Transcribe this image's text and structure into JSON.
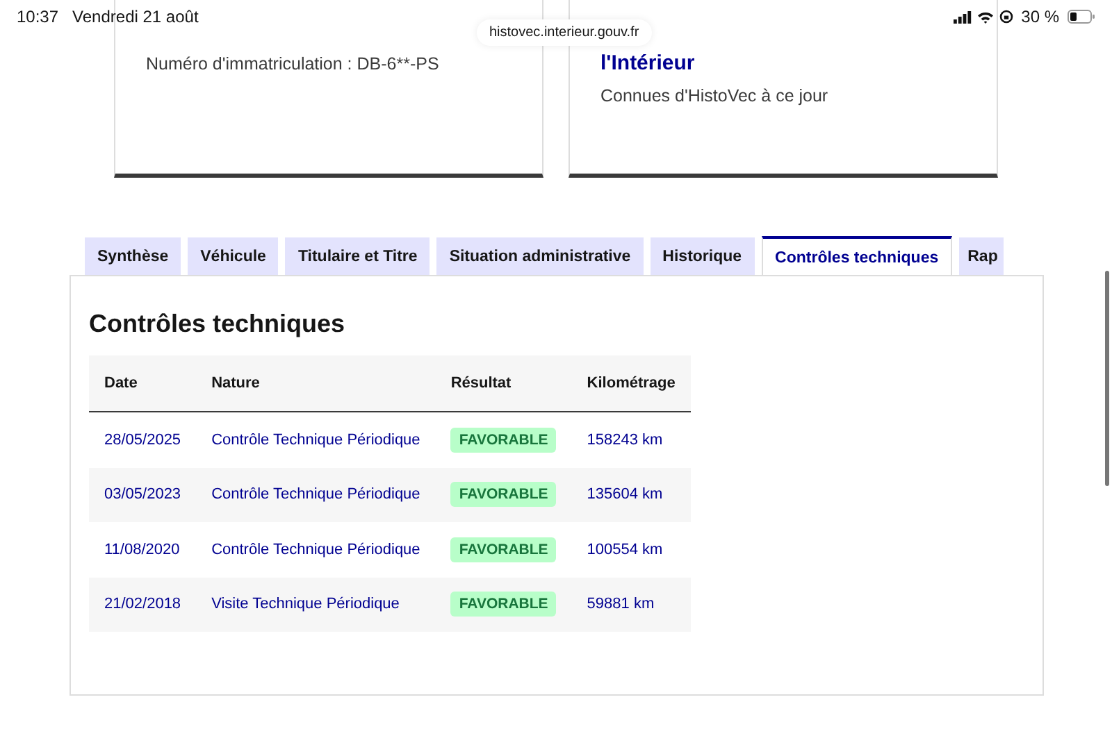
{
  "status_bar": {
    "time": "10:37",
    "date": "Vendredi 21 août",
    "url": "histovec.interieur.gouv.fr",
    "battery": "30 %"
  },
  "cards": [
    {
      "text": "Numéro d'immatriculation : DB-6**-PS"
    },
    {
      "title": "l'Intérieur",
      "text": "Connues d'HistoVec à ce jour"
    }
  ],
  "tabs": [
    {
      "label": "Synthèse",
      "selected": false
    },
    {
      "label": "Véhicule",
      "selected": false
    },
    {
      "label": "Titulaire et Titre",
      "selected": false
    },
    {
      "label": "Situation administrative",
      "selected": false
    },
    {
      "label": "Historique",
      "selected": false
    },
    {
      "label": "Contrôles techniques",
      "selected": true
    },
    {
      "label": "Rap",
      "selected": false
    }
  ],
  "panel": {
    "title": "Contrôles techniques",
    "table": {
      "columns": [
        "Date",
        "Nature",
        "Résultat",
        "Kilométrage"
      ],
      "rows": [
        {
          "date": "28/05/2025",
          "nature": "Contrôle Technique Périodique",
          "result": "FAVORABLE",
          "mileage": "158243 km"
        },
        {
          "date": "03/05/2023",
          "nature": "Contrôle Technique Périodique",
          "result": "FAVORABLE",
          "mileage": "135604 km"
        },
        {
          "date": "11/08/2020",
          "nature": "Contrôle Technique Périodique",
          "result": "FAVORABLE",
          "mileage": "100554 km"
        },
        {
          "date": "21/02/2018",
          "nature": "Visite Technique Périodique",
          "result": "FAVORABLE",
          "mileage": "59881 km"
        }
      ]
    }
  }
}
